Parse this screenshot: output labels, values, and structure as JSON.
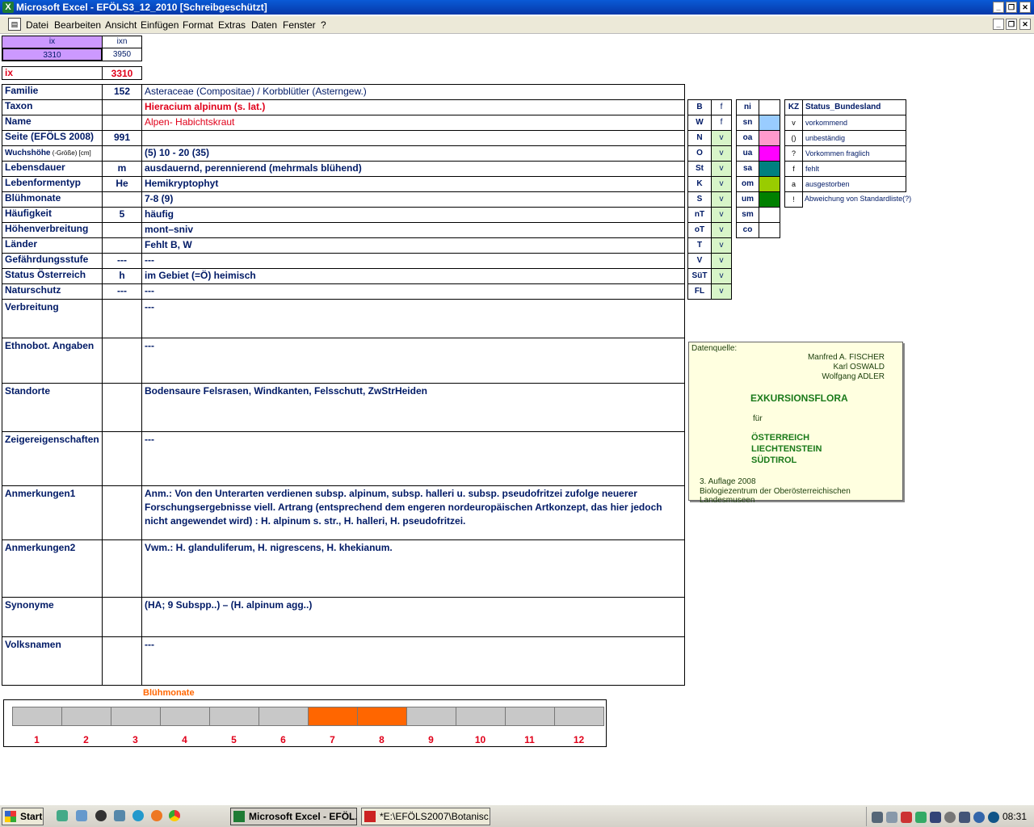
{
  "window": {
    "title": "Microsoft Excel - EFÖLS3_12_2010  [Schreibgeschützt]"
  },
  "menu": [
    "Datei",
    "Bearbeiten",
    "Ansicht",
    "Einfügen",
    "Format",
    "Extras",
    "Daten",
    "Fenster",
    "?"
  ],
  "index": {
    "ix_label": "ix",
    "ixn_label": "ixn",
    "ix_value": "3310",
    "ixn_value": "3950",
    "ix_big_label": "ix",
    "ix_big_value": "3310"
  },
  "rows": [
    {
      "label": "Familie",
      "num": "152",
      "value": "Asteraceae (Compositae)  /  Korbblütler (Asterngew.)",
      "style": "normal"
    },
    {
      "label": "Taxon",
      "num": "",
      "value": "Hieracium alpinum (s. lat.)",
      "style": "redbold"
    },
    {
      "label": "Name",
      "num": "",
      "value": "Alpen- Habichtskraut",
      "style": "red"
    },
    {
      "label": "Seite (EFÖLS 2008)",
      "num": "991",
      "value": "",
      "style": "normal"
    },
    {
      "label": "Wuchshöhe",
      "label_suffix": " (-Größe) [cm]",
      "num": "",
      "value": " (5) 10 - 20 (35)",
      "style": "bold"
    },
    {
      "label": "Lebensdauer",
      "num": "m",
      "value": "ausdauernd, perennierend (mehrmals blühend)",
      "style": "bold"
    },
    {
      "label": "Lebenformentyp",
      "num": "He",
      "value": "Hemikryptophyt",
      "style": "bold"
    },
    {
      "label": "Blühmonate",
      "num": "",
      "value": " 7-8 (9)",
      "style": "bold"
    },
    {
      "label": "Häufigkeit",
      "num": "5",
      "value": "häufig",
      "style": "bold"
    },
    {
      "label": "Höhenverbreitung",
      "num": "",
      "value": "mont–sniv",
      "style": "bold"
    },
    {
      "label": "Länder",
      "num": "",
      "value": "Fehlt B, W",
      "style": "bold"
    },
    {
      "label": "Gefährdungsstufe",
      "num": "---",
      "value": "  ---",
      "style": "bold"
    },
    {
      "label": "Status Österreich",
      "num": "h",
      "value": "im Gebiet (=Ö) heimisch",
      "style": "bold"
    },
    {
      "label": "Naturschutz",
      "num": "---",
      "value": " ---",
      "style": "bold"
    }
  ],
  "bigrows": [
    {
      "label": "Verbreitung",
      "value": " ---"
    },
    {
      "label": "Ethnobot. Angaben",
      "value": "---"
    },
    {
      "label": "Standorte",
      "value": "Bodensaure Felsrasen, Windkanten, Felsschutt, ZwStrHeiden"
    },
    {
      "label": "Zeigereigenschaften",
      "value": "---"
    },
    {
      "label": "Anmerkungen1",
      "value": "Anm.: Von den Unterarten verdienen subsp. alpinum, subsp. halleri u. subsp. pseudofritzei zufolge neuerer Forschungsergebnisse viell. Artrang (entsprechend dem engeren nordeuropäischen Artkonzept, das hier jedoch nicht angewendet wird) : H. alpinum s. str., H. halleri, H. pseudofritzei."
    },
    {
      "label": "Anmerkungen2",
      "value": "Vwm.: H. glanduliferum, H. nigrescens, H. khekianum."
    },
    {
      "label": "Synonyme",
      "value": "(HA; 9 Subspp..) – (H. alpinum agg..)"
    },
    {
      "label": "Volksnamen",
      "value": "---"
    }
  ],
  "countries": [
    {
      "code": "B",
      "status": "f"
    },
    {
      "code": "W",
      "status": "f"
    },
    {
      "code": "N",
      "status": "v"
    },
    {
      "code": "O",
      "status": "v"
    },
    {
      "code": "St",
      "status": "v"
    },
    {
      "code": "K",
      "status": "v"
    },
    {
      "code": "S",
      "status": "v"
    },
    {
      "code": "nT",
      "status": "v"
    },
    {
      "code": "oT",
      "status": "v"
    },
    {
      "code": "T",
      "status": "v"
    },
    {
      "code": "V",
      "status": "v"
    },
    {
      "code": "SüT",
      "status": "v"
    },
    {
      "code": "FL",
      "status": "v"
    }
  ],
  "altitude": [
    {
      "code": "ni",
      "color": ""
    },
    {
      "code": "sn",
      "color": "#99ccff"
    },
    {
      "code": "oa",
      "color": "#ff99cc"
    },
    {
      "code": "ua",
      "color": "#ff00ff"
    },
    {
      "code": "sa",
      "color": "#008080"
    },
    {
      "code": "om",
      "color": "#99cc00"
    },
    {
      "code": "um",
      "color": "#008000"
    },
    {
      "code": "sm",
      "color": ""
    },
    {
      "code": "co",
      "color": ""
    }
  ],
  "legend": {
    "header_kz": "KZ",
    "header_status": "Status_Bundesland",
    "items": [
      {
        "kz": "v",
        "text": "vorkommend"
      },
      {
        "kz": "()",
        "text": "unbeständig"
      },
      {
        "kz": "?",
        "text": "Vorkommen fraglich"
      },
      {
        "kz": "f",
        "text": "fehlt"
      },
      {
        "kz": "a",
        "text": "ausgestorben"
      },
      {
        "kz": "!",
        "text": "Abweichung von Standardliste(?)"
      }
    ]
  },
  "source": {
    "label": "Datenquelle:",
    "author1": "Manfred A. FISCHER",
    "author2": "Karl OSWALD",
    "author3": "Wolfgang ADLER",
    "title": "EXKURSIONSFLORA",
    "fuer": "für",
    "country1": "ÖSTERREICH",
    "country2": "LIECHTENSTEIN",
    "country3": "SÜDTIROL",
    "edition": "3. Auflage 2008",
    "publisher": "Biologiezentrum der Oberösterreichischen Landesmuseen"
  },
  "bloom": {
    "title": "Blühmonate",
    "months": [
      "1",
      "2",
      "3",
      "4",
      "5",
      "6",
      "7",
      "8",
      "9",
      "10",
      "11",
      "12"
    ],
    "active": [
      7,
      8
    ]
  },
  "taskbar": {
    "start": "Start",
    "task1": "Microsoft Excel - EFÖL...",
    "task2": "*E:\\EFÖLS2007\\Botanisc...",
    "clock": "08:31"
  },
  "colors": {
    "title_bar": "#0a5ad6",
    "bloom_active": "#ff6600",
    "bloom_inactive": "#c8c8c8",
    "highlight_purple": "#cc99ff",
    "status_green": "#d8f5c8"
  }
}
